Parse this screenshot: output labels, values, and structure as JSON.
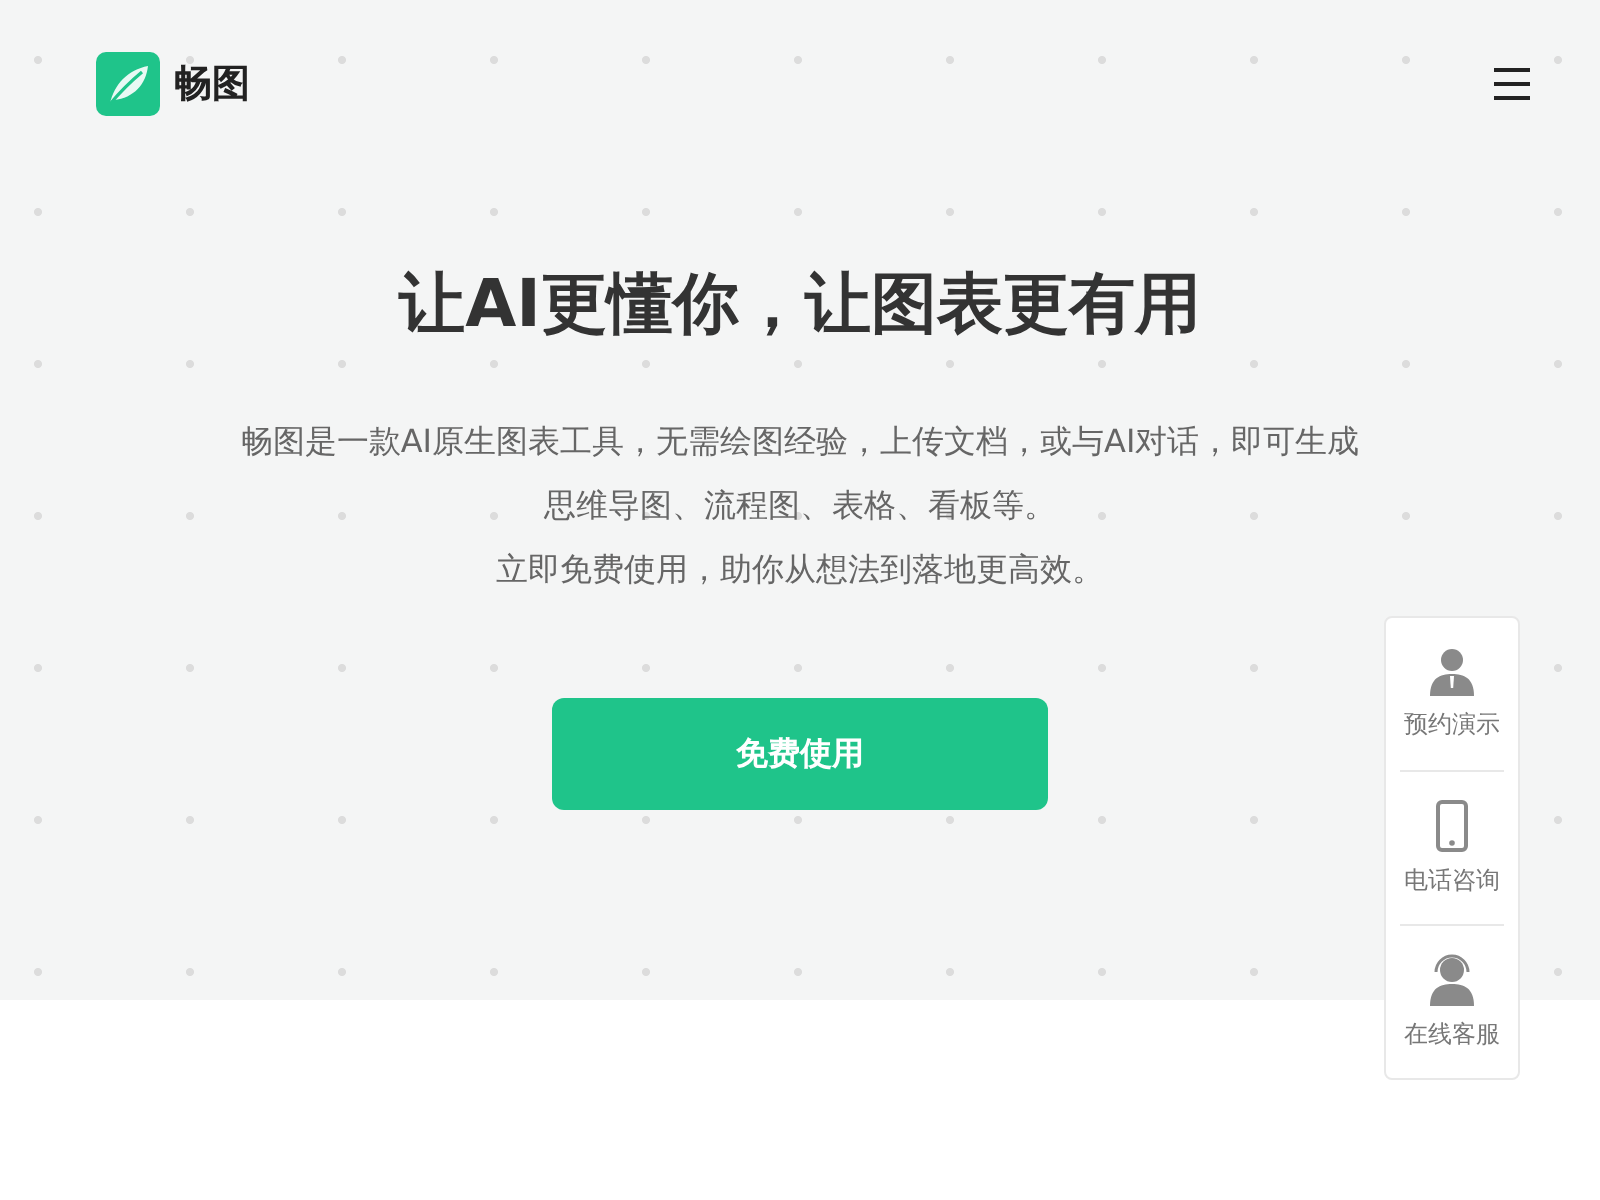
{
  "header": {
    "logo_text": "畅图"
  },
  "hero": {
    "title": "让AI更懂你，让图表更有用",
    "description_lines": [
      "畅图是一款AI原生图表工具，无需绘图经验，上传文档，或与AI对话，即可生成",
      "思维导图、流程图、表格、看板等。",
      "立即免费使用，助你从想法到落地更高效。"
    ],
    "cta_button": "免费使用"
  },
  "side_panel": [
    {
      "kind": "demo",
      "label": "预约演示"
    },
    {
      "kind": "phone",
      "label": "电话咨询"
    },
    {
      "kind": "support",
      "label": "在线客服"
    }
  ]
}
